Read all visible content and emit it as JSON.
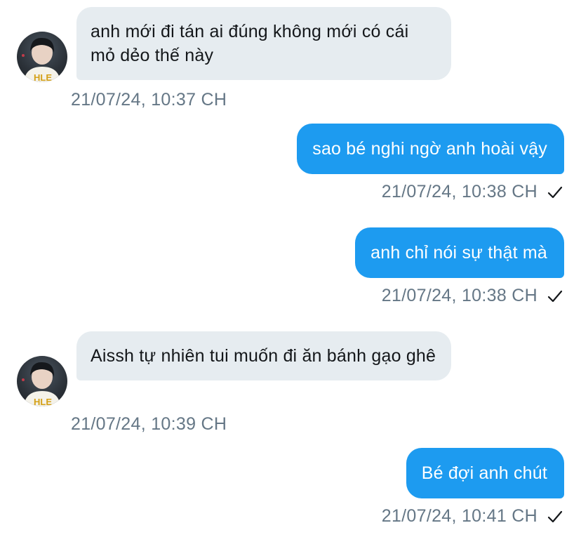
{
  "messages": [
    {
      "direction": "incoming",
      "text": "anh mới đi tán ai đúng không mới có cái mỏ dẻo thế này",
      "timestamp": "21/07/24, 10:37 CH"
    },
    {
      "direction": "outgoing",
      "text": "sao bé nghi ngờ anh hoài vậy",
      "timestamp": "21/07/24, 10:38 CH"
    },
    {
      "direction": "outgoing",
      "text": "anh chỉ nói sự thật mà",
      "timestamp": "21/07/24, 10:38 CH"
    },
    {
      "direction": "incoming",
      "text": "Aissh tự nhiên tui muốn đi ăn bánh gạo ghê",
      "timestamp": "21/07/24, 10:39 CH"
    },
    {
      "direction": "outgoing",
      "text": "Bé đợi anh chút",
      "timestamp": "21/07/24, 10:41 CH"
    }
  ],
  "colors": {
    "incoming_bubble": "#e6ecf0",
    "outgoing_bubble": "#1d9bf0",
    "timestamp_text": "#657786"
  },
  "icons": {
    "read_receipt": "checkmark-icon",
    "avatar": "avatar"
  }
}
